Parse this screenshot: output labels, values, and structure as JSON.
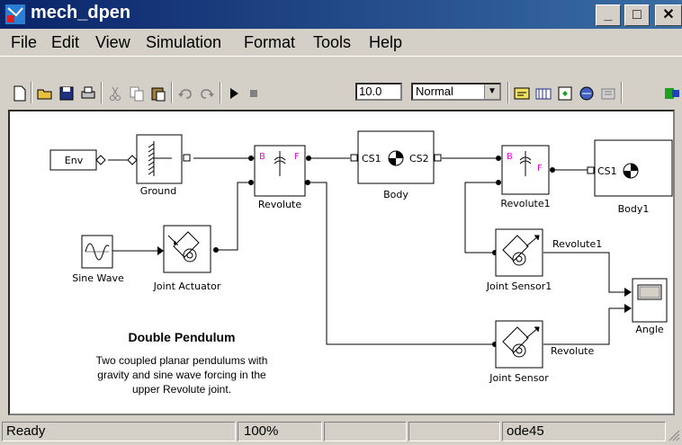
{
  "window": {
    "title": "mech_dpen"
  },
  "menu": [
    "File",
    "Edit",
    "View",
    "Simulation",
    "Format",
    "Tools",
    "Help"
  ],
  "toolbar": {
    "stop_time": "10.0",
    "sim_mode": "Normal"
  },
  "blocks": {
    "env": "Env",
    "ground": "Ground",
    "revolute": "Revolute",
    "body": "Body",
    "revolute1": "Revolute1",
    "body1": "Body1",
    "sine_wave": "Sine Wave",
    "joint_actuator": "Joint Actuator",
    "joint_sensor1": "Joint Sensor1",
    "joint_sensor": "Joint Sensor",
    "angle": "Angle"
  },
  "port_labels": {
    "b": "B",
    "f": "F",
    "cs1": "CS1",
    "cs2": "CS2"
  },
  "signals": {
    "revolute1": "Revolute1",
    "revolute": "Revolute"
  },
  "annotation": {
    "title": "Double Pendulum",
    "line1": "Two coupled planar pendulums with",
    "line2": "gravity and sine wave forcing in the",
    "line3": "upper Revolute joint."
  },
  "status": {
    "ready": "Ready",
    "zoom": "100%",
    "solver": "ode45"
  }
}
